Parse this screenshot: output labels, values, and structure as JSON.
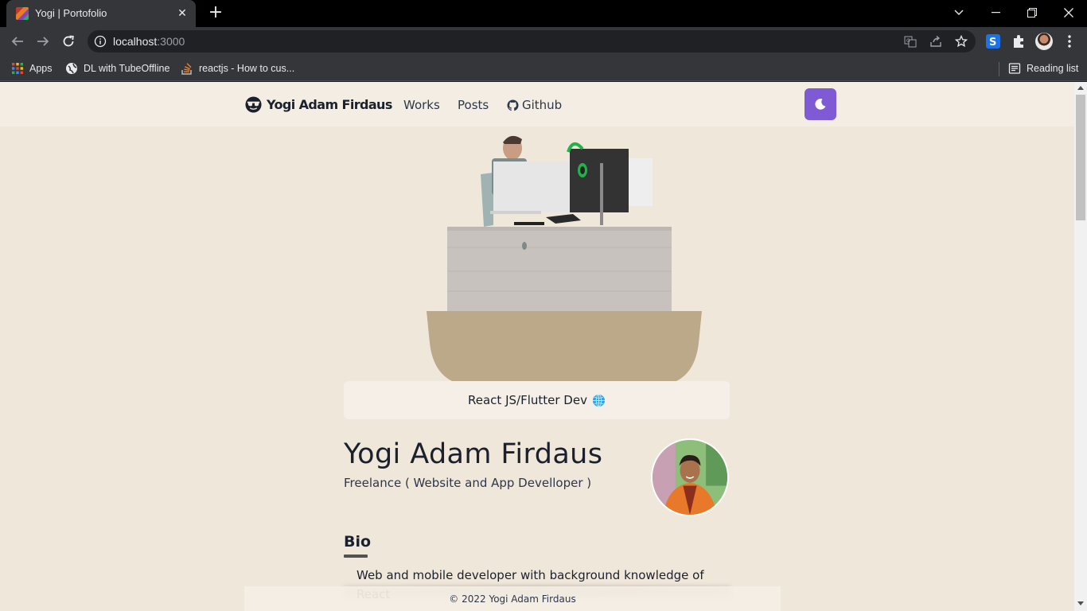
{
  "browser": {
    "tab_title": "Yogi | Portofolio",
    "url_host": "localhost",
    "url_port": ":3000",
    "bookmarks": [
      {
        "label": "Apps",
        "icon": "apps-grid-icon"
      },
      {
        "label": "DL with TubeOffline",
        "icon": "globe-icon"
      },
      {
        "label": "reactjs - How to cus...",
        "icon": "stackoverflow-icon"
      }
    ],
    "reading_list": "Reading list"
  },
  "site": {
    "logo_text": "Yogi Adam Firdaus",
    "nav": {
      "works": "Works",
      "posts": "Posts",
      "github": "Github"
    },
    "theme_toggle_icon": "moon-icon",
    "accent_color": "#805ad5",
    "background_color": "#f0e7db"
  },
  "hero": {
    "banner_text": "React JS/Flutter Dev"
  },
  "profile": {
    "name": "Yogi Adam Firdaus",
    "subtitle": "Freelance ( Website and App Develloper )"
  },
  "bio": {
    "title": "Bio",
    "text": "Web and mobile developer with background knowledge of React"
  },
  "footer": {
    "text": "© 2022 Yogi Adam Firdaus"
  }
}
